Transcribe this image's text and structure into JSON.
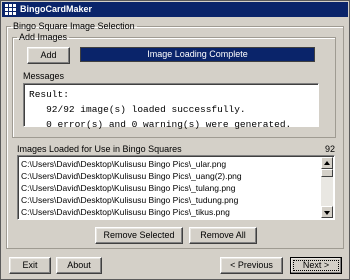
{
  "window": {
    "title": "BingoCardMaker",
    "icon": "grid-app-icon"
  },
  "section": {
    "title": "Bingo Square Image Selection"
  },
  "add_images": {
    "group_title": "Add Images",
    "add_label": "Add",
    "progress_text": "Image Loading Complete",
    "progress_value": 1.0
  },
  "messages": {
    "title": "Messages",
    "lines": [
      "Result:",
      "   92/92 image(s) loaded successfully.",
      "   0 error(s) and 0 warning(s) were generated."
    ]
  },
  "images_list": {
    "label": "Images Loaded for Use in Bingo Squares",
    "count": "92",
    "items": [
      "C:\\Users\\David\\Desktop\\Kulisusu Bingo Pics\\_ular.png",
      "C:\\Users\\David\\Desktop\\Kulisusu Bingo Pics\\_uang(2).png",
      "C:\\Users\\David\\Desktop\\Kulisusu Bingo Pics\\_tulang.png",
      "C:\\Users\\David\\Desktop\\Kulisusu Bingo Pics\\_tudung.png",
      "C:\\Users\\David\\Desktop\\Kulisusu Bingo Pics\\_tikus.png"
    ],
    "remove_selected_label": "Remove Selected",
    "remove_all_label": "Remove All"
  },
  "footer": {
    "exit_label": "Exit",
    "about_label": "About",
    "previous_label": "< Previous",
    "next_label": "Next >"
  },
  "colors": {
    "progress": "#0a246a",
    "titlebar": "#0a246a",
    "face": "#d4d0c8"
  }
}
